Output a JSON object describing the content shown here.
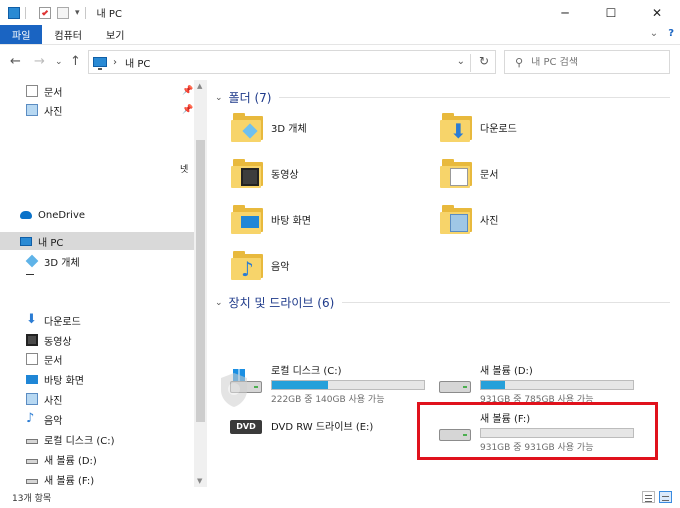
{
  "window": {
    "title": "내 PC",
    "minimize": "─",
    "maximize": "☐",
    "close": "✕"
  },
  "ribbon": {
    "tabs": [
      "파일",
      "컴퓨터",
      "보기"
    ],
    "collapse_icon": "⌄",
    "help_icon": "?"
  },
  "address": {
    "back": "←",
    "forward": "→",
    "recent": "⌄",
    "up": "↑",
    "separator": "›",
    "path": "내 PC",
    "dropdown": "⌄",
    "refresh": "↻"
  },
  "search": {
    "icon": "⚲",
    "placeholder": "내 PC 검색"
  },
  "nav": {
    "quick": [
      {
        "label": "문서",
        "icon": "document-icon",
        "pinned": true
      },
      {
        "label": "사진",
        "icon": "picture-icon",
        "pinned": true
      }
    ],
    "fragment": "넷",
    "onedrive": "OneDrive",
    "thispc": "내 PC",
    "pc_children": [
      {
        "label": "3D 개체",
        "icon": "3d-object-icon"
      },
      {
        "label": "다운로드",
        "icon": "download-icon"
      },
      {
        "label": "동영상",
        "icon": "video-icon"
      },
      {
        "label": "문서",
        "icon": "document-icon"
      },
      {
        "label": "바탕 화면",
        "icon": "desktop-icon"
      },
      {
        "label": "사진",
        "icon": "picture-icon"
      },
      {
        "label": "음악",
        "icon": "music-icon"
      },
      {
        "label": "로컬 디스크 (C:)",
        "icon": "drive-icon"
      },
      {
        "label": "새 볼륨 (D:)",
        "icon": "drive-icon"
      },
      {
        "label": "새 볼륨 (F:)",
        "icon": "drive-icon"
      }
    ]
  },
  "folders_group": {
    "label": "폴더 (7)",
    "chevron": "⌄"
  },
  "folders": [
    {
      "label": "3D 개체",
      "icon": "3d-object-icon"
    },
    {
      "label": "다운로드",
      "icon": "download-icon"
    },
    {
      "label": "동영상",
      "icon": "video-icon"
    },
    {
      "label": "문서",
      "icon": "document-icon"
    },
    {
      "label": "바탕 화면",
      "icon": "desktop-icon"
    },
    {
      "label": "사진",
      "icon": "picture-icon"
    },
    {
      "label": "음악",
      "icon": "music-icon"
    }
  ],
  "devices_group": {
    "label": "장치 및 드라이브 (6)",
    "chevron": "⌄"
  },
  "drives": [
    {
      "name": "로컬 디스크 (C:)",
      "usage": "222GB 중 140GB 사용 가능",
      "used_fraction": 0.37,
      "icon": "windows-drive-icon"
    },
    {
      "name": "새 볼륨 (D:)",
      "usage": "931GB 중 785GB 사용 가능",
      "used_fraction": 0.16,
      "icon": "drive-icon"
    },
    {
      "name": "DVD RW 드라이브 (E:)",
      "icon": "dvd-drive-icon"
    },
    {
      "name": "새 볼륨 (F:)",
      "usage": "931GB 중 931GB 사용 가능",
      "used_fraction": 0.0,
      "icon": "drive-icon"
    }
  ],
  "status": {
    "count": "13개 항목"
  },
  "colors": {
    "accent": "#1a64c2",
    "bar_fill": "#26a0da",
    "highlight": "#e0121c",
    "folder": "#f7d46a"
  }
}
